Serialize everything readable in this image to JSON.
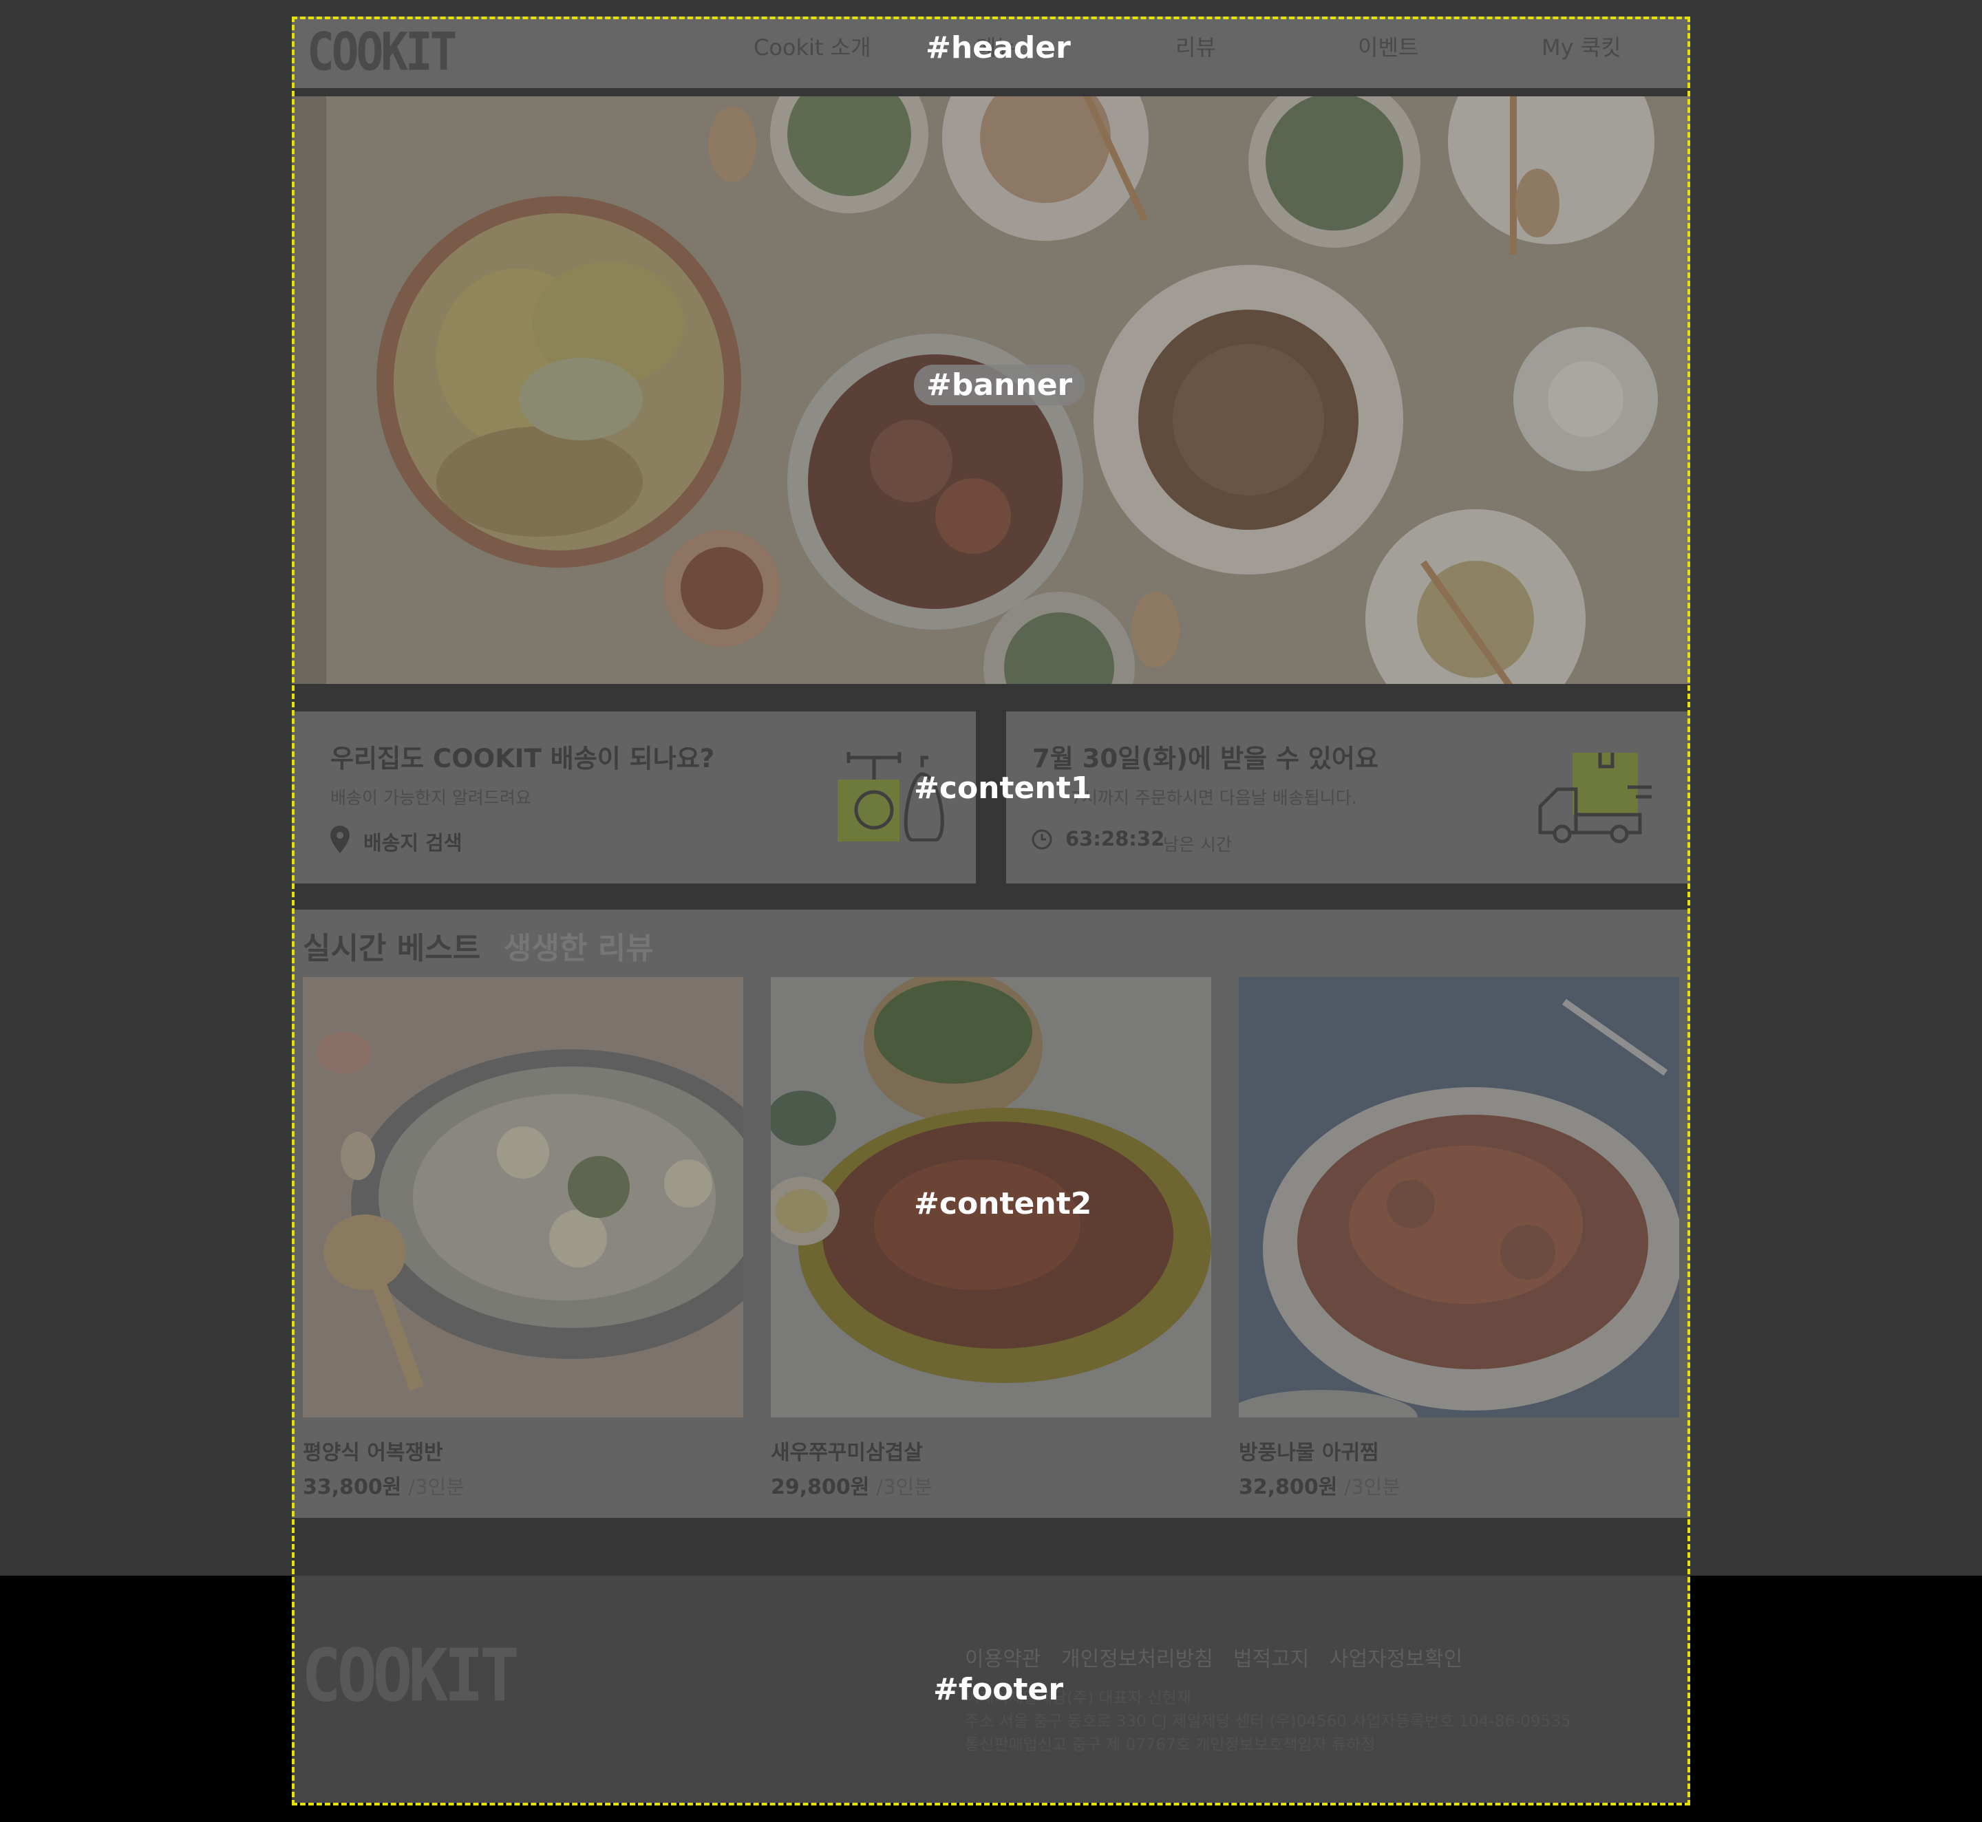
{
  "header": {
    "logo": "COOKIT",
    "nav": [
      "Cookit 소개",
      "메뉴",
      "리뷰",
      "이벤트",
      "My 쿡킷"
    ]
  },
  "content1": {
    "delivery_check": {
      "title": "우리집도 COOKIT 배송이 되나요?",
      "subtitle": "배송이 가능한지 알려드려요",
      "link": "배송지 검색",
      "icon": "scale-bag-icon"
    },
    "delivery_date": {
      "title": "7월 30일(화)에 받을 수 있어요",
      "subtitle": "7시까지 주문하시면 다음날 배송됩니다.",
      "timer": "63:28:32",
      "timer_label": "남은 시간",
      "icon": "delivery-truck-icon"
    }
  },
  "content2": {
    "tabs": [
      "실시간 베스트",
      "생생한 리뷰"
    ],
    "products": [
      {
        "name": "평양식 어복쟁반",
        "price": "33,800원",
        "unit": "/3인분"
      },
      {
        "name": "새우쭈꾸미삼겹살",
        "price": "29,800원",
        "unit": "/3인분"
      },
      {
        "name": "방풍나물 아귀찜",
        "price": "32,800원",
        "unit": "/3인분"
      }
    ]
  },
  "footer": {
    "logo": "COOKIT",
    "links": [
      "이용약관",
      "개인정보처리방침",
      "법적고지",
      "사업자정보확인"
    ],
    "company": "씨제이제일제당(주) 대표자 신현재",
    "address": "주소 서울 중구 동호로 330 CJ 제일제당 센터 (우)04560 사업자등록번호 104-86-09535",
    "license": "통신판매업신고 중구 제 07767호 개인정보보호책임자 류하정"
  },
  "regions": {
    "header": "#header",
    "banner": "#banner",
    "content1": "#content1",
    "content2": "#content2",
    "footer": "#footer"
  },
  "colors": {
    "outline": "#e3e200",
    "page_bg": "#363636",
    "footer_bg": "#000000"
  }
}
